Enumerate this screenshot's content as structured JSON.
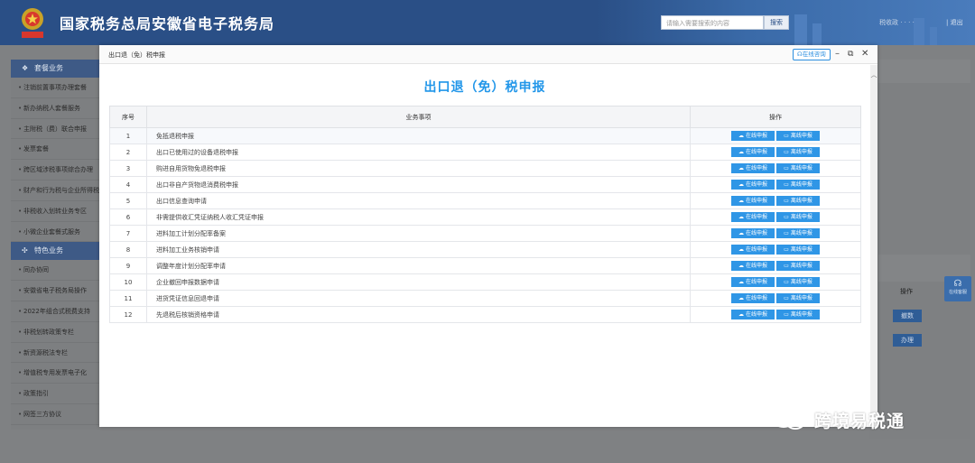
{
  "header": {
    "site_title": "国家税务总局安徽省电子税务局",
    "search_placeholder": "请输入需要搜索的内容",
    "search_button": "搜索",
    "links": "税收政 · · · ·",
    "exit": "| 退出"
  },
  "sidebar": {
    "sections": [
      {
        "title": "套餐业务",
        "icon": "grid-icon",
        "items": [
          "注销前置事项办理套餐",
          "新办纳税人套餐服务",
          "主附税（费）联合申报",
          "发票套餐",
          "跨区域涉税事项综合办理",
          "财产和行为税与企业所得税",
          "非税收入划转业务专区",
          "小微企业套餐式服务"
        ]
      },
      {
        "title": "特色业务",
        "icon": "clover-icon",
        "items": [
          "同办协同",
          "安徽省电子税务局操作",
          "2022年组合式税费支持",
          "非税划转政策专栏",
          "新资源税法专栏",
          "增值税专用发票电子化",
          "政策指引",
          "网签三方协议"
        ]
      }
    ]
  },
  "background": {
    "operation_header": "操作",
    "btn_cancel": "撤数",
    "btn_handle": "办理",
    "float_label": "在线客服"
  },
  "modal": {
    "title": "出口退（免）税申报",
    "consult_label": "在线咨询",
    "heading": "出口退（免）税申报",
    "columns": {
      "no": "序号",
      "item": "业务事项",
      "op": "操作"
    },
    "online_label": "在线申报",
    "offline_label": "离线申报",
    "rows": [
      {
        "no": "1",
        "name": "免抵退税申报"
      },
      {
        "no": "2",
        "name": "出口已使用过的设备退税申报"
      },
      {
        "no": "3",
        "name": "购进自用货物免退税申报"
      },
      {
        "no": "4",
        "name": "出口非自产货物退消费税申报"
      },
      {
        "no": "5",
        "name": "出口信息查询申请"
      },
      {
        "no": "6",
        "name": "非需提供收汇凭证纳税人收汇凭证申报"
      },
      {
        "no": "7",
        "name": "进料加工计划分配率备案"
      },
      {
        "no": "8",
        "name": "进料加工业务核销申请"
      },
      {
        "no": "9",
        "name": "调整年度计划分配率申请"
      },
      {
        "no": "10",
        "name": "企业撤回申报数据申请"
      },
      {
        "no": "11",
        "name": "进货凭证信息回退申请"
      },
      {
        "no": "12",
        "name": "先退税后核销资格申请"
      }
    ]
  },
  "watermark": {
    "text": "跨境易税通"
  },
  "colors": {
    "header_bg": "#2a4f86",
    "accent": "#2196e9",
    "button": "#2f96e6"
  }
}
